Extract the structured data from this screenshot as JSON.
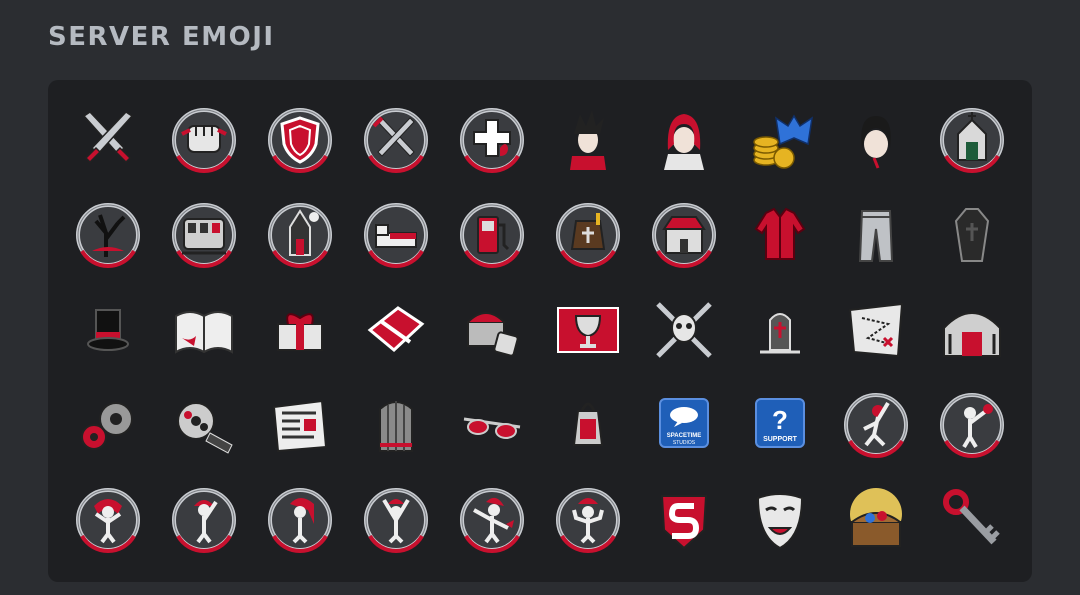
{
  "header": {
    "title": "SERVER EMOJI"
  },
  "colors": {
    "background": "#2b2d31",
    "panel": "#1e1f22",
    "title": "#b5bac1",
    "accent_red": "#c8102e",
    "silver": "#c9ccd1"
  },
  "emoji": [
    {
      "icon": "crossed-swords-icon",
      "ring": false
    },
    {
      "icon": "fist-icon",
      "ring": true
    },
    {
      "icon": "shield-icon",
      "ring": true
    },
    {
      "icon": "crossed-swords-badge-icon",
      "ring": true
    },
    {
      "icon": "medical-cross-icon",
      "ring": true
    },
    {
      "icon": "spiky-hair-vampire-icon",
      "ring": false
    },
    {
      "icon": "red-hair-character-icon",
      "ring": false
    },
    {
      "icon": "coins-bat-icon",
      "ring": false
    },
    {
      "icon": "black-hair-head-icon",
      "ring": false
    },
    {
      "icon": "crypt-badge-icon",
      "ring": true
    },
    {
      "icon": "dead-tree-badge-icon",
      "ring": true
    },
    {
      "icon": "train-badge-icon",
      "ring": true
    },
    {
      "icon": "church-badge-icon",
      "ring": true
    },
    {
      "icon": "bedroom-badge-icon",
      "ring": true
    },
    {
      "icon": "gas-station-badge-icon",
      "ring": true
    },
    {
      "icon": "coffin-room-badge-icon",
      "ring": true
    },
    {
      "icon": "shop-badge-icon",
      "ring": true
    },
    {
      "icon": "red-jacket-icon",
      "ring": false
    },
    {
      "icon": "grey-pants-icon",
      "ring": false
    },
    {
      "icon": "coffin-icon",
      "ring": false
    },
    {
      "icon": "top-hat-icon",
      "ring": false
    },
    {
      "icon": "open-book-icon",
      "ring": false
    },
    {
      "icon": "gift-box-icon",
      "ring": false
    },
    {
      "icon": "wrapped-book-icon",
      "ring": false
    },
    {
      "icon": "treasure-chest-dice-icon",
      "ring": false
    },
    {
      "icon": "chalice-banner-icon",
      "ring": false
    },
    {
      "icon": "skull-swords-icon",
      "ring": false
    },
    {
      "icon": "tombstone-icon",
      "ring": false
    },
    {
      "icon": "treasure-map-icon",
      "ring": false
    },
    {
      "icon": "mausoleum-icon",
      "ring": false
    },
    {
      "icon": "gears-icon",
      "ring": false
    },
    {
      "icon": "film-reel-icon",
      "ring": false
    },
    {
      "icon": "newspaper-icon",
      "ring": false
    },
    {
      "icon": "wooden-door-icon",
      "ring": false
    },
    {
      "icon": "sunglasses-icon",
      "ring": false
    },
    {
      "icon": "lantern-icon",
      "ring": false
    },
    {
      "icon": "spacetime-studios-icon",
      "ring": false,
      "label_line1": "SPACETIME",
      "label_line2": "STUDIOS"
    },
    {
      "icon": "support-question-icon",
      "ring": false,
      "label_line1": "SUPPORT"
    },
    {
      "icon": "dancer-badge-icon",
      "ring": true
    },
    {
      "icon": "pointing-figure-badge-icon",
      "ring": true
    },
    {
      "icon": "woman-pose-badge-icon",
      "ring": true
    },
    {
      "icon": "woman-wave-badge-icon",
      "ring": true
    },
    {
      "icon": "woman-hair-badge-icon",
      "ring": true
    },
    {
      "icon": "woman-arms-up-badge-icon",
      "ring": true
    },
    {
      "icon": "woman-dab-badge-icon",
      "ring": true
    },
    {
      "icon": "woman-shrug-badge-icon",
      "ring": true
    },
    {
      "icon": "s-shield-icon",
      "ring": false
    },
    {
      "icon": "theater-mask-icon",
      "ring": false
    },
    {
      "icon": "treasure-chest-glow-icon",
      "ring": false
    },
    {
      "icon": "skeleton-key-icon",
      "ring": false
    }
  ]
}
